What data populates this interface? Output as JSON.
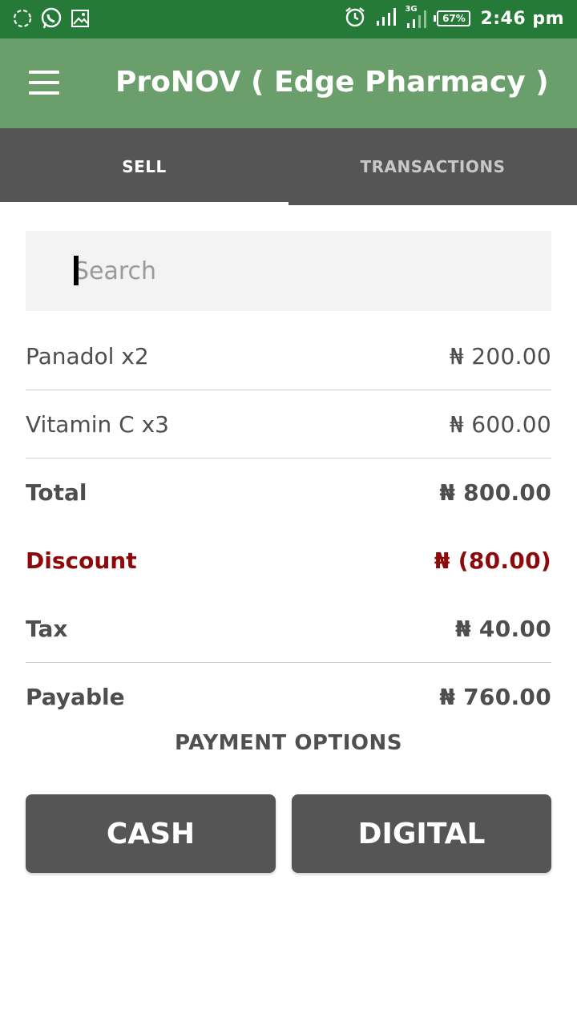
{
  "status_bar": {
    "left_icons": [
      "sync-icon",
      "whatsapp-icon",
      "image-icon"
    ],
    "right_icons": [
      "alarm-icon",
      "signal-icon",
      "signal-3g-icon"
    ],
    "network": "3G",
    "battery": "67%",
    "time": "2:46 pm"
  },
  "app_bar": {
    "title": "ProNOV ( Edge Pharmacy )",
    "menu_icon": "menu-icon"
  },
  "tabs": [
    {
      "label": "SELL",
      "active": true
    },
    {
      "label": "TRANSACTIONS",
      "active": false
    }
  ],
  "search": {
    "placeholder": "Search",
    "value": ""
  },
  "items": [
    {
      "name": "Panadol x2",
      "amount": "₦ 200.00"
    },
    {
      "name": "Vitamin C x3",
      "amount": "₦ 600.00"
    }
  ],
  "summary": {
    "total": {
      "label": "Total",
      "amount": "₦ 800.00"
    },
    "discount": {
      "label": "Discount",
      "amount": "₦ (80.00)"
    },
    "tax": {
      "label": "Tax",
      "amount": "₦ 40.00"
    },
    "payable": {
      "label": "Payable",
      "amount": "₦ 760.00"
    }
  },
  "payment": {
    "title": "PAYMENT OPTIONS",
    "cash_label": "CASH",
    "digital_label": "DIGITAL"
  },
  "colors": {
    "status_bar": "#247a36",
    "app_bar": "#6a9f6b",
    "tab_bar": "#555555",
    "discount": "#8e0a0a",
    "button": "#555555"
  }
}
